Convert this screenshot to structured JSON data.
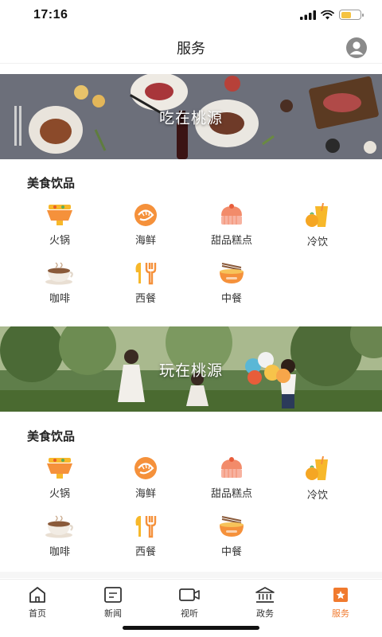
{
  "status_bar": {
    "time": "17:16",
    "battery_level": 0.55
  },
  "header": {
    "title": "服务",
    "avatar_icon": "user-avatar-icon"
  },
  "banners": [
    {
      "label": "吃在桃源"
    },
    {
      "label": "玩在桃源"
    }
  ],
  "sections": [
    {
      "title": "美食饮品",
      "items": [
        {
          "label": "火锅",
          "icon": "hotpot-icon"
        },
        {
          "label": "海鲜",
          "icon": "shrimp-icon"
        },
        {
          "label": "甜品糕点",
          "icon": "cake-icon"
        },
        {
          "label": "冷饮",
          "icon": "cold-drink-icon"
        },
        {
          "label": "咖啡",
          "icon": "coffee-icon"
        },
        {
          "label": "西餐",
          "icon": "western-food-icon"
        },
        {
          "label": "中餐",
          "icon": "chinese-food-icon"
        }
      ]
    },
    {
      "title": "美食饮品",
      "items": [
        {
          "label": "火锅",
          "icon": "hotpot-icon"
        },
        {
          "label": "海鲜",
          "icon": "shrimp-icon"
        },
        {
          "label": "甜品糕点",
          "icon": "cake-icon"
        },
        {
          "label": "冷饮",
          "icon": "cold-drink-icon"
        },
        {
          "label": "咖啡",
          "icon": "coffee-icon"
        },
        {
          "label": "西餐",
          "icon": "western-food-icon"
        },
        {
          "label": "中餐",
          "icon": "chinese-food-icon"
        }
      ]
    }
  ],
  "tab_bar": {
    "tabs": [
      {
        "label": "首页",
        "icon": "home-icon"
      },
      {
        "label": "新闻",
        "icon": "news-icon"
      },
      {
        "label": "视听",
        "icon": "video-icon"
      },
      {
        "label": "政务",
        "icon": "government-icon"
      },
      {
        "label": "服务",
        "icon": "service-icon"
      }
    ],
    "active_index": 4
  },
  "colors": {
    "accent": "#f07a2e",
    "icon_orange": "#f5913b",
    "icon_yellow": "#f7b82a"
  }
}
